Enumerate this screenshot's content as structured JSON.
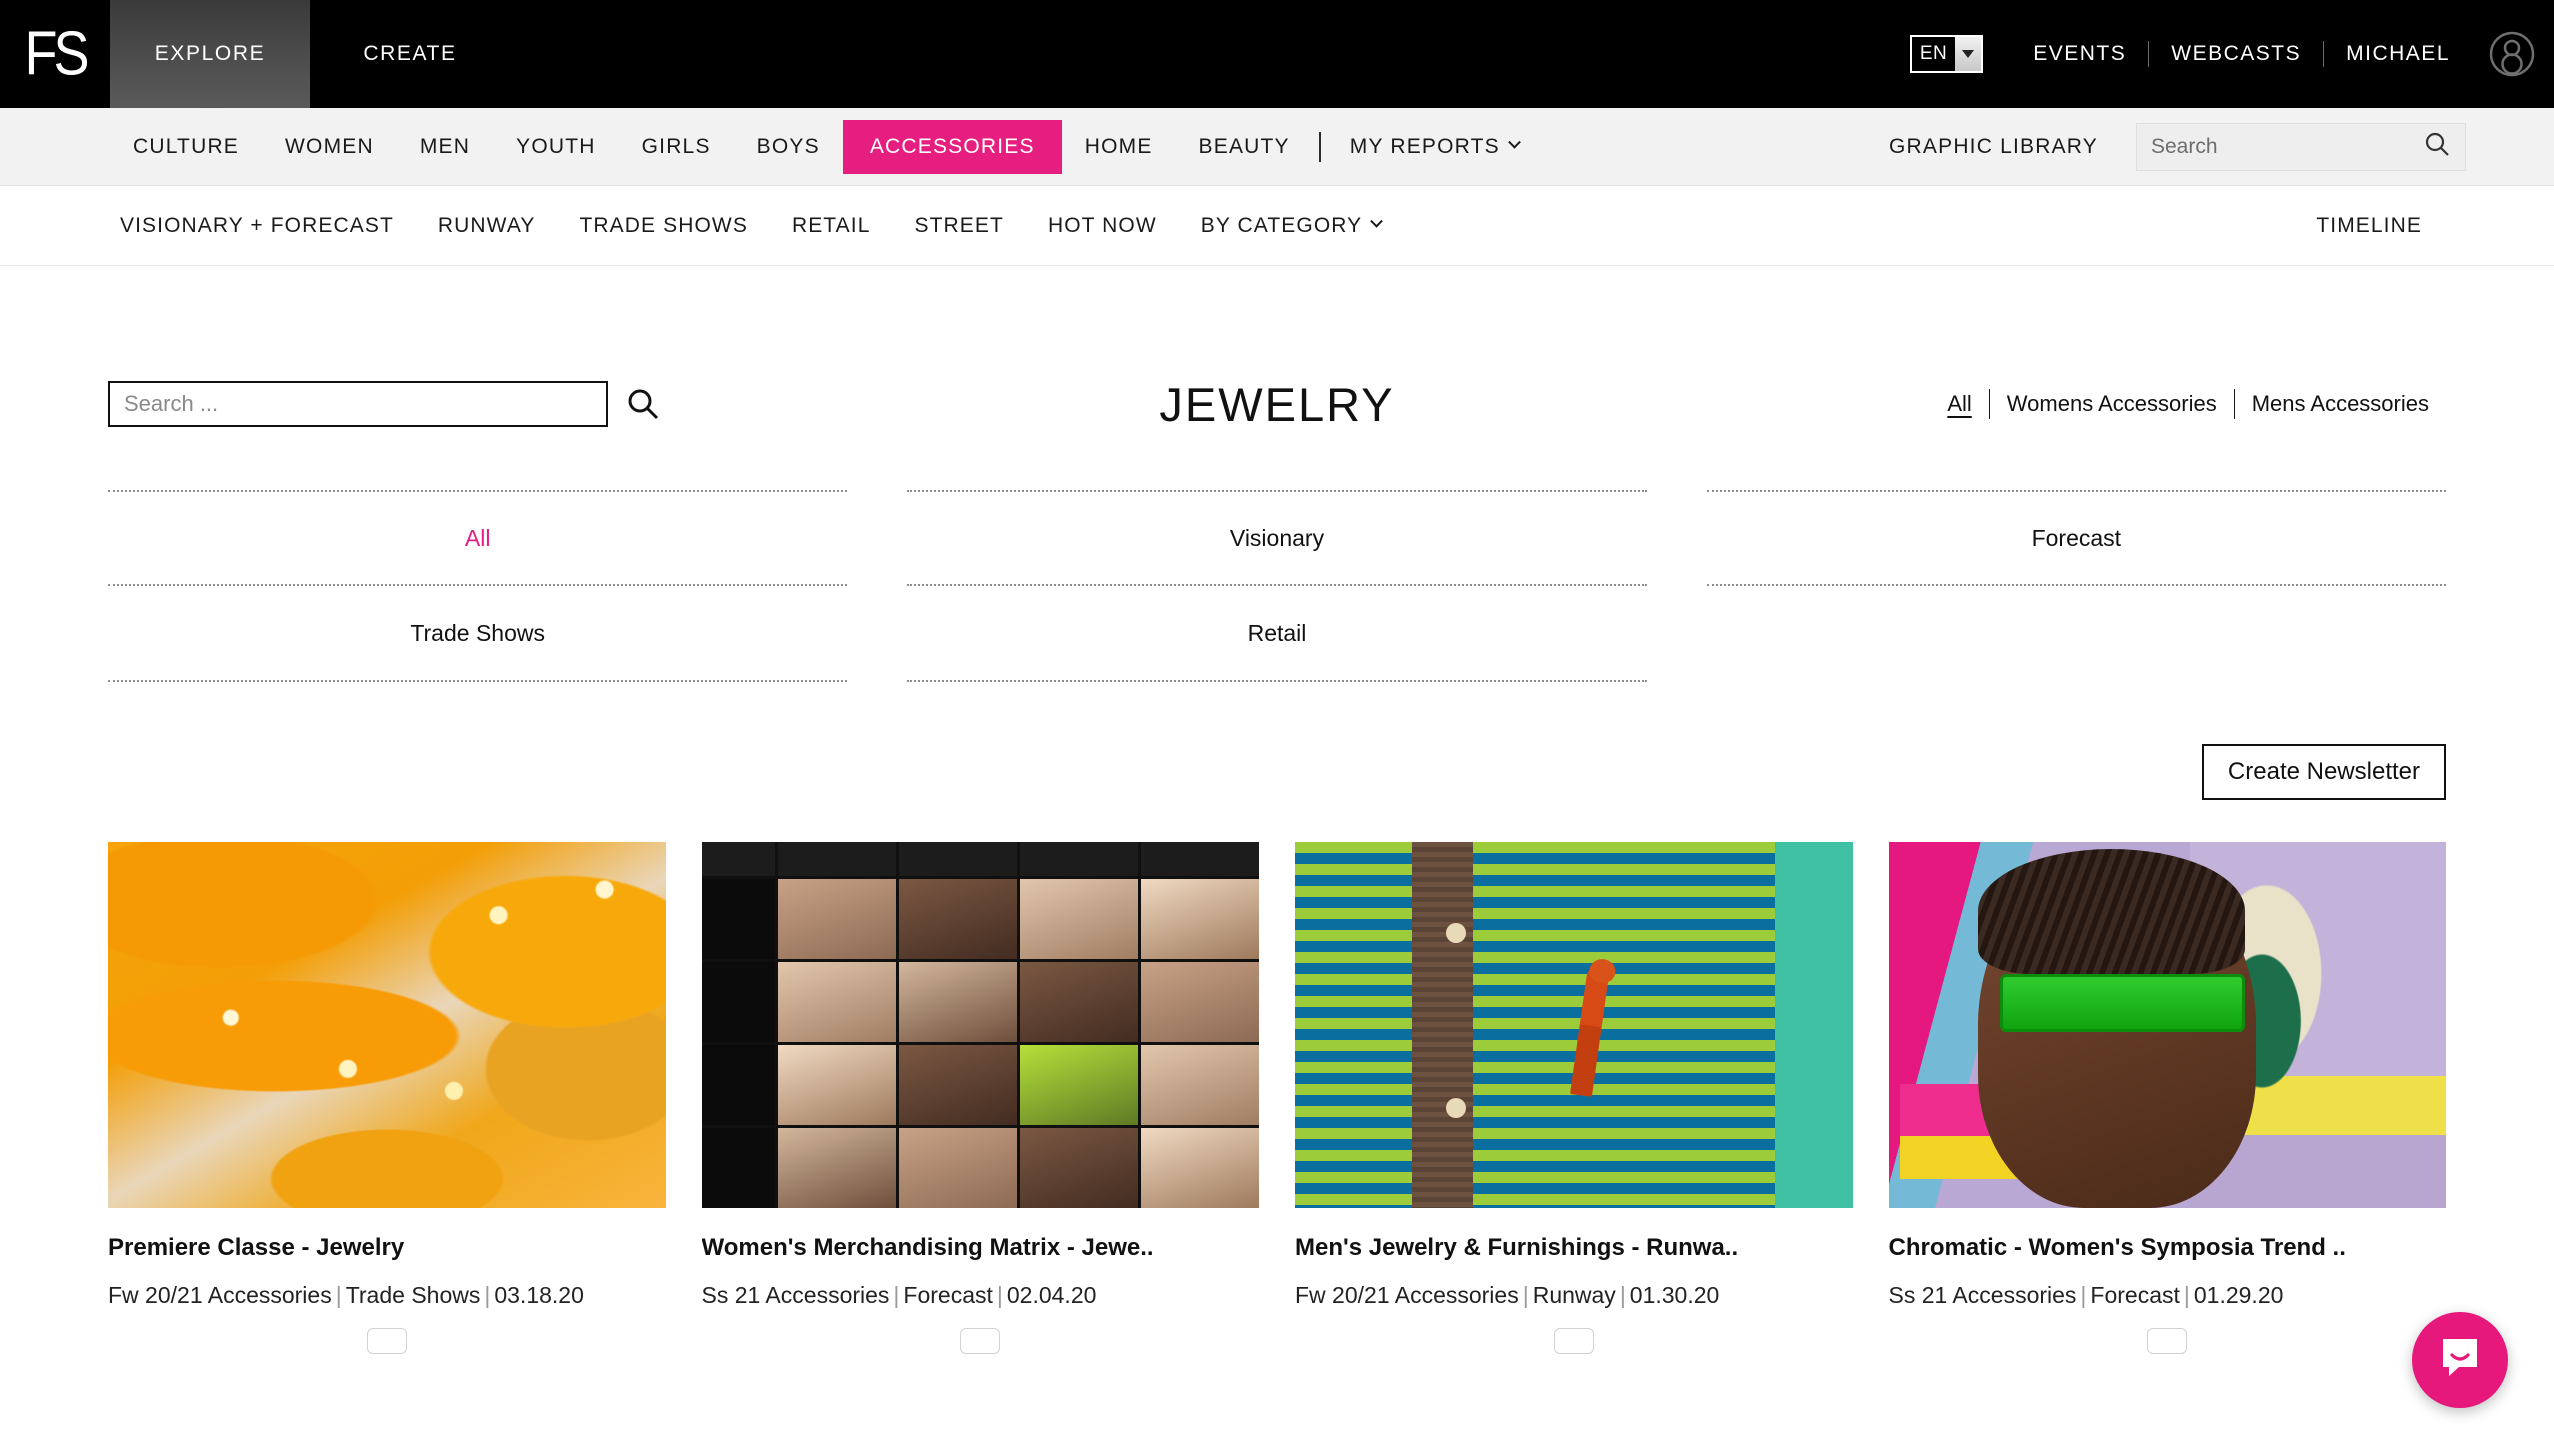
{
  "brand": {
    "logo_text": "FS"
  },
  "topbar": {
    "primary_nav": [
      {
        "label": "EXPLORE",
        "active": true
      },
      {
        "label": "CREATE",
        "active": false
      }
    ],
    "language": {
      "value": "EN"
    },
    "links": [
      "EVENTS",
      "WEBCASTS"
    ],
    "user_name": "MICHAEL",
    "avatar_icon": "user-avatar-icon"
  },
  "nav_secondary": {
    "items": [
      {
        "label": "CULTURE",
        "style": "plain"
      },
      {
        "label": "WOMEN",
        "style": "plain"
      },
      {
        "label": "MEN",
        "style": "plain"
      },
      {
        "label": "YOUTH",
        "style": "plain"
      },
      {
        "label": "GIRLS",
        "style": "plain"
      },
      {
        "label": "BOYS",
        "style": "plain"
      },
      {
        "label": "ACCESSORIES",
        "style": "pill"
      },
      {
        "label": "HOME",
        "style": "plain"
      },
      {
        "label": "BEAUTY",
        "style": "plain"
      }
    ],
    "my_reports": "MY REPORTS",
    "graphic_library": "GRAPHIC LIBRARY",
    "search_placeholder": "Search"
  },
  "nav_tertiary": {
    "items": [
      "VISIONARY + FORECAST",
      "RUNWAY",
      "TRADE SHOWS",
      "RETAIL",
      "STREET",
      "HOT NOW",
      "BY CATEGORY"
    ],
    "timeline": "TIMELINE"
  },
  "main": {
    "search_placeholder": "Search ...",
    "title": "JEWELRY",
    "gender_filters": [
      {
        "label": "All",
        "active": true
      },
      {
        "label": "Womens Accessories",
        "active": false
      },
      {
        "label": "Mens Accessories",
        "active": false
      }
    ],
    "categories": [
      {
        "label": "All",
        "active": true
      },
      {
        "label": "Visionary",
        "active": false
      },
      {
        "label": "Forecast",
        "active": false
      },
      {
        "label": "Trade Shows",
        "active": false
      },
      {
        "label": "Retail",
        "active": false
      }
    ],
    "newsletter_button": "Create Newsletter",
    "cards": [
      {
        "title": "Premiere Classe - Jewelry",
        "season": "Fw 20/21 Accessories",
        "category": "Trade Shows",
        "date": "03.18.20"
      },
      {
        "title": "Women's Merchandising Matrix - Jewe..",
        "season": "Ss 21 Accessories",
        "category": "Forecast",
        "date": "02.04.20"
      },
      {
        "title": "Men's Jewelry & Furnishings - Runwa..",
        "season": "Fw 20/21 Accessories",
        "category": "Runway",
        "date": "01.30.20"
      },
      {
        "title": "Chromatic - Women's Symposia Trend ..",
        "season": "Ss 21 Accessories",
        "category": "Forecast",
        "date": "01.29.20"
      }
    ]
  },
  "chat": {
    "icon": "chat-bubble-icon"
  },
  "colors": {
    "accent_pink": "#e61e7f",
    "topbar_black": "#000000",
    "nav_grey": "#f2f2f2"
  }
}
